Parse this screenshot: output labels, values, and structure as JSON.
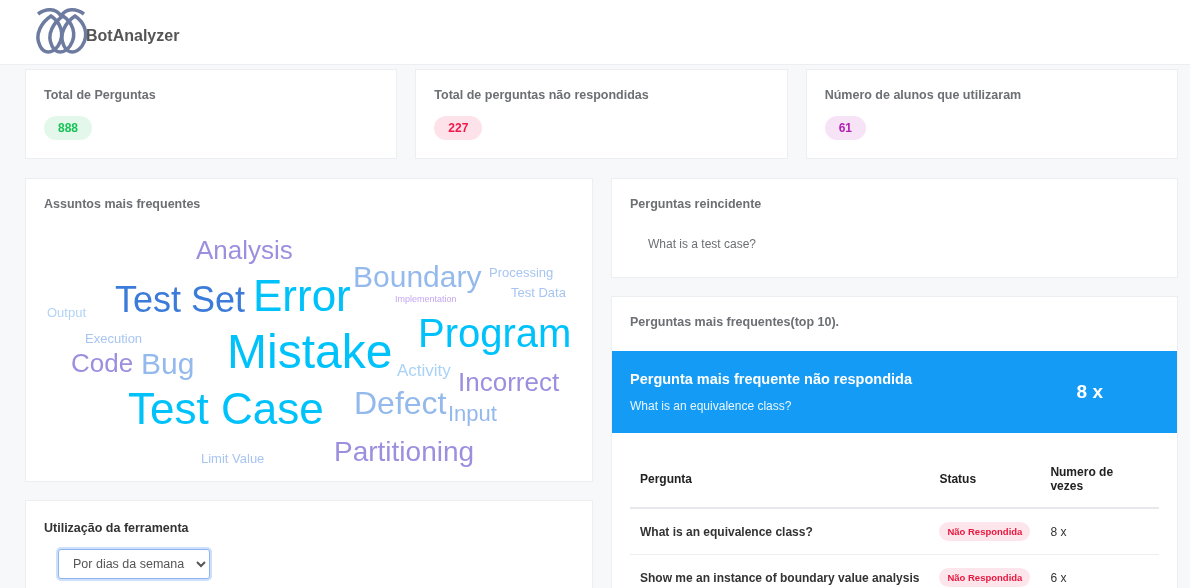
{
  "header": {
    "brand": "BotAnalyzer"
  },
  "stats": [
    {
      "label": "Total de Perguntas",
      "value": "888",
      "color": "#19c257"
    },
    {
      "label": "Total de perguntas não respondidas",
      "value": "227",
      "color": "#f2164a"
    },
    {
      "label": "Número de alunos que utilizaram",
      "value": "61",
      "color": "#b31fb5"
    }
  ],
  "word_cloud": {
    "title": "Assuntos mais frequentes",
    "words": [
      {
        "text": "Analysis",
        "color": "#9d8fdf"
      },
      {
        "text": "Boundary",
        "color": "#94b9ec"
      },
      {
        "text": "Processing",
        "color": "#a8c5f1"
      },
      {
        "text": "Test Set",
        "color": "#3b7bd9"
      },
      {
        "text": "Error",
        "color": "#00c2fb"
      },
      {
        "text": "Implementation",
        "color": "#c6a7f1"
      },
      {
        "text": "Test Data",
        "color": "#a8c5f1"
      },
      {
        "text": "Output",
        "color": "#b3d3f6"
      },
      {
        "text": "Execution",
        "color": "#a8c5f1"
      },
      {
        "text": "Mistake",
        "color": "#00c2fb"
      },
      {
        "text": "Program",
        "color": "#00c2fb"
      },
      {
        "text": "Code",
        "color": "#9d8fdf"
      },
      {
        "text": "Bug",
        "color": "#94b9ec"
      },
      {
        "text": "Activity",
        "color": "#a9d3f6"
      },
      {
        "text": "Incorrect",
        "color": "#9d8fdf"
      },
      {
        "text": "Test Case",
        "color": "#00c2fb"
      },
      {
        "text": "Defect",
        "color": "#94b9ec"
      },
      {
        "text": "Input",
        "color": "#94b9ec"
      },
      {
        "text": "Limit Value",
        "color": "#a8c5f1"
      },
      {
        "text": "Partitioning",
        "color": "#9d8fdf"
      }
    ]
  },
  "usage": {
    "title": "Utilização da ferramenta",
    "select_value": "Por dias da semana"
  },
  "recurring": {
    "title": "Perguntas reincidente",
    "question": "What is a test case?"
  },
  "top_questions": {
    "title": "Perguntas mais frequentes(top 10).",
    "highlight": {
      "title": "Pergunta mais frequente não respondida",
      "question": "What is an equivalence class?",
      "count": "8 x"
    },
    "columns": [
      "Pergunta",
      "Status",
      "Numero de vezes"
    ],
    "rows": [
      {
        "question": "What is an equivalence class?",
        "status": "Não Respondida",
        "count": "8 x"
      },
      {
        "question": "Show me an instance of boundary value analysis",
        "status": "Não Respondida",
        "count": "6 x"
      }
    ]
  }
}
